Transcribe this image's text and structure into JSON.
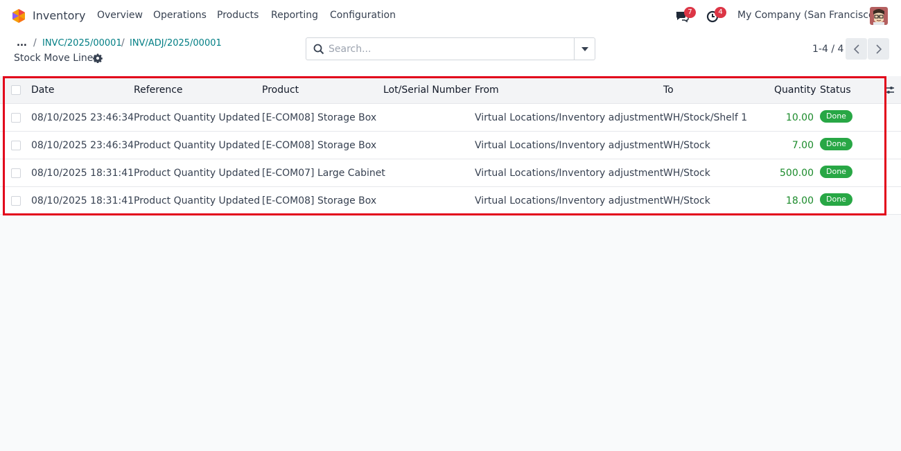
{
  "navbar": {
    "app_name": "Inventory",
    "menu": [
      "Overview",
      "Operations",
      "Products",
      "Reporting",
      "Configuration"
    ],
    "messages_count": "7",
    "activities_count": "4",
    "company": "My Company (San Francisco)"
  },
  "breadcrumb": {
    "ellipsis": "...",
    "items": [
      "INVC/2025/00001",
      "INV/ADJ/2025/00001"
    ]
  },
  "page_title": "Stock Move Lines",
  "search": {
    "placeholder": "Search..."
  },
  "pager": {
    "value": "1-4 / 4"
  },
  "table": {
    "headers": {
      "date": "Date",
      "reference": "Reference",
      "product": "Product",
      "lot": "Lot/Serial Number",
      "from": "From",
      "to": "To",
      "quantity": "Quantity",
      "status": "Status"
    },
    "rows": [
      {
        "date": "08/10/2025 23:46:34",
        "reference": "Product Quantity Updated",
        "product": "[E-COM08] Storage Box",
        "lot": "",
        "from": "Virtual Locations/Inventory adjustment",
        "to": "WH/Stock/Shelf 1",
        "quantity": "10.00",
        "status": "Done"
      },
      {
        "date": "08/10/2025 23:46:34",
        "reference": "Product Quantity Updated",
        "product": "[E-COM08] Storage Box",
        "lot": "",
        "from": "Virtual Locations/Inventory adjustment",
        "to": "WH/Stock",
        "quantity": "7.00",
        "status": "Done"
      },
      {
        "date": "08/10/2025 18:31:41",
        "reference": "Product Quantity Updated",
        "product": "[E-COM07] Large Cabinet",
        "lot": "",
        "from": "Virtual Locations/Inventory adjustment",
        "to": "WH/Stock",
        "quantity": "500.00",
        "status": "Done"
      },
      {
        "date": "08/10/2025 18:31:41",
        "reference": "Product Quantity Updated",
        "product": "[E-COM08] Storage Box",
        "lot": "",
        "from": "Virtual Locations/Inventory adjustment",
        "to": "WH/Stock",
        "quantity": "18.00",
        "status": "Done"
      }
    ]
  },
  "colors": {
    "accent": "#017e84",
    "done_badge": "#28a745",
    "quantity_text": "#1a8a2a",
    "highlight_border": "#e2001a",
    "notification_badge": "#dc3545"
  },
  "icons": [
    "app-logo-icon",
    "chat-icon",
    "clock-icon",
    "gear-icon",
    "search-icon",
    "caret-down-icon",
    "chevron-left-icon",
    "chevron-right-icon",
    "optional-columns-icon"
  ]
}
